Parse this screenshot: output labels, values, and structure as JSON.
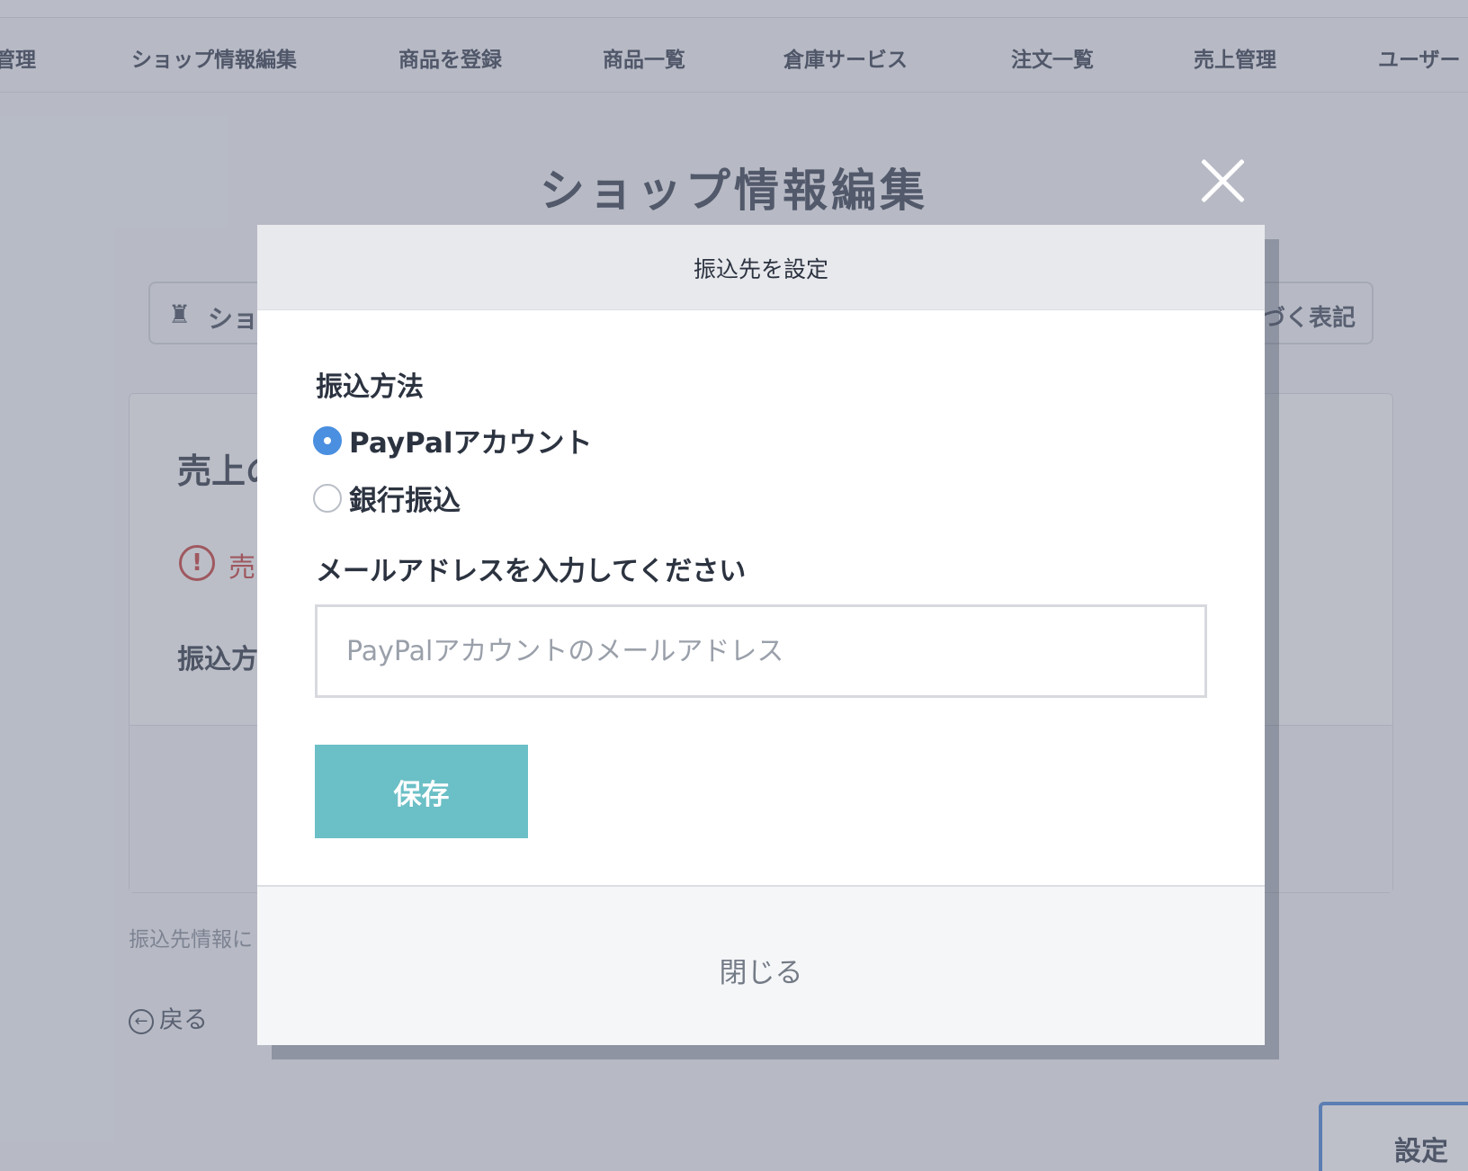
{
  "nav": {
    "items": [
      "管理",
      "ショップ情報編集",
      "商品を登録",
      "商品一覧",
      "倉庫サービス",
      "注文一覧",
      "売上管理",
      "ユーザー"
    ]
  },
  "page": {
    "title": "ショップ情報編集",
    "tab_left": "ショ",
    "tab_right": "づく表記",
    "card_title": "売上の",
    "warning_text": "売",
    "card_sub": "振込方",
    "bg_button": "設定",
    "note": "振込先情報に",
    "back": "戻る"
  },
  "modal": {
    "title": "振込先を設定",
    "method_label": "振込方法",
    "options": [
      {
        "label": "PayPalアカウント",
        "checked": true
      },
      {
        "label": "銀行振込",
        "checked": false
      }
    ],
    "email_label": "メールアドレスを入力してください",
    "email_value": "",
    "email_placeholder": "PayPalアカウントのメールアドレス",
    "save_label": "保存",
    "close_label": "閉じる"
  },
  "colors": {
    "accent_save": "#6bbfc6",
    "radio_checked": "#4a8fe0",
    "warning": "#c8423f"
  }
}
